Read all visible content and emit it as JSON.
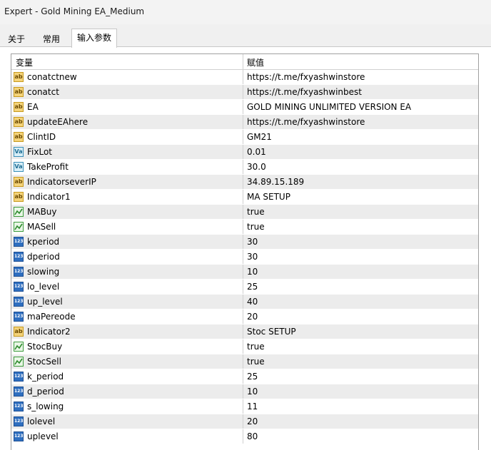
{
  "window": {
    "title": "Expert - Gold Mining EA_Medium"
  },
  "tabs": [
    {
      "label": "关于",
      "active": false
    },
    {
      "label": "常用",
      "active": false
    },
    {
      "label": "输入参数",
      "active": true
    }
  ],
  "table": {
    "headers": [
      "变量",
      "赋值"
    ],
    "rows": [
      {
        "type": "string",
        "icon": "ab",
        "name": "conatctnew",
        "value": "https://t.me/fxyashwinstore"
      },
      {
        "type": "string",
        "icon": "ab",
        "name": "conatct",
        "value": "https://t.me/fxyashwinbest"
      },
      {
        "type": "string",
        "icon": "ab",
        "name": "EA",
        "value": "GOLD MINING UNLIMITED VERSION EA"
      },
      {
        "type": "string",
        "icon": "ab",
        "name": "updateEAhere",
        "value": "https://t.me/fxyashwinstore"
      },
      {
        "type": "string",
        "icon": "ab",
        "name": "ClintID",
        "value": "GM21"
      },
      {
        "type": "double",
        "icon": "Va",
        "name": "FixLot",
        "value": "0.01"
      },
      {
        "type": "double",
        "icon": "Va",
        "name": "TakeProfit",
        "value": "30.0"
      },
      {
        "type": "string",
        "icon": "ab",
        "name": "IndicatorseverIP",
        "value": "34.89.15.189"
      },
      {
        "type": "string",
        "icon": "ab",
        "name": "Indicator1",
        "value": "MA SETUP"
      },
      {
        "type": "bool",
        "icon": "",
        "name": "MABuy",
        "value": "true"
      },
      {
        "type": "bool",
        "icon": "",
        "name": "MASell",
        "value": "true"
      },
      {
        "type": "int",
        "icon": "123",
        "name": "kperiod",
        "value": "30"
      },
      {
        "type": "int",
        "icon": "123",
        "name": "dperiod",
        "value": "30"
      },
      {
        "type": "int",
        "icon": "123",
        "name": "slowing",
        "value": "10"
      },
      {
        "type": "int",
        "icon": "123",
        "name": "lo_level",
        "value": "25"
      },
      {
        "type": "int",
        "icon": "123",
        "name": "up_level",
        "value": "40"
      },
      {
        "type": "int",
        "icon": "123",
        "name": "maPereode",
        "value": "20"
      },
      {
        "type": "string",
        "icon": "ab",
        "name": "Indicator2",
        "value": "Stoc SETUP"
      },
      {
        "type": "bool",
        "icon": "",
        "name": "StocBuy",
        "value": "true"
      },
      {
        "type": "bool",
        "icon": "",
        "name": "StocSell",
        "value": "true"
      },
      {
        "type": "int",
        "icon": "123",
        "name": "k_period",
        "value": "25"
      },
      {
        "type": "int",
        "icon": "123",
        "name": "d_period",
        "value": "10"
      },
      {
        "type": "int",
        "icon": "123",
        "name": "s_lowing",
        "value": "11"
      },
      {
        "type": "int",
        "icon": "123",
        "name": "lolevel",
        "value": "20"
      },
      {
        "type": "int",
        "icon": "123",
        "name": "uplevel",
        "value": "80"
      }
    ]
  }
}
